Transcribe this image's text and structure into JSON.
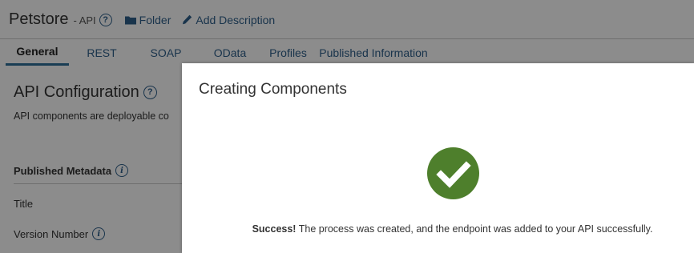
{
  "header": {
    "title": "Petstore",
    "type": "- API",
    "help_glyph": "?",
    "folder_label": "Folder",
    "add_description_label": "Add Description"
  },
  "tabs": [
    {
      "label": "General",
      "active": true
    },
    {
      "label": "REST",
      "active": false
    },
    {
      "label": "SOAP",
      "active": false
    },
    {
      "label": "OData",
      "active": false
    },
    {
      "label": "Profiles",
      "active": false
    },
    {
      "label": "Published Information",
      "active": false
    }
  ],
  "main": {
    "section_title": "API Configuration",
    "section_desc": "API components are deployable co",
    "published_metadata_heading": "Published Metadata",
    "fields": [
      {
        "label": "Title"
      },
      {
        "label": "Version Number"
      }
    ],
    "info_glyph": "i"
  },
  "modal": {
    "title": "Creating Components",
    "success_strong": "Success!",
    "success_message": " The process was created, and the endpoint was added to your API successfully.",
    "success_color": "#4e7f2c"
  },
  "colors": {
    "link": "#2f5f8a",
    "tab_active_underline": "#2f6f9a",
    "overlay": "rgba(0,0,0,0.45)"
  },
  "icons": {
    "help": "help-circle-icon",
    "folder": "folder-icon",
    "edit": "pencil-icon",
    "info": "info-circle-icon",
    "success": "check-circle-icon"
  }
}
